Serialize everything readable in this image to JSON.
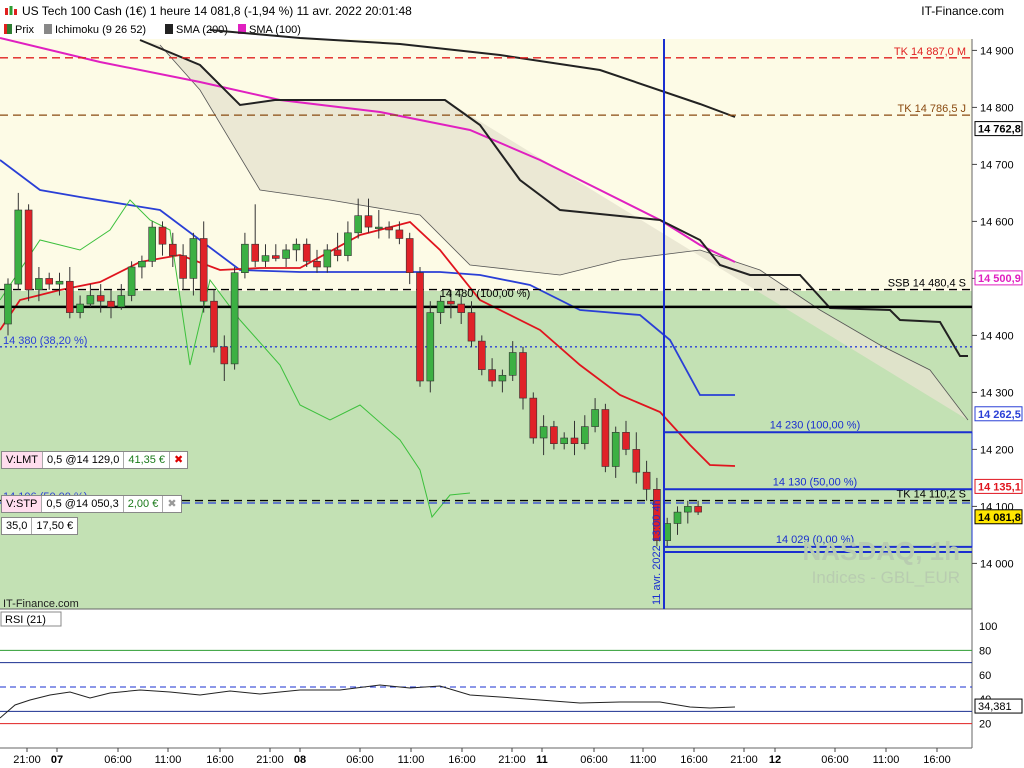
{
  "header": {
    "title": "US Tech 100 Cash (1€) 1 heure 14 081,8 (-1,94 %) 11 avr. 2022 20:01:48",
    "site": "IT-Finance.com"
  },
  "legend": [
    {
      "label": "Prix",
      "color": "#2e7d32"
    },
    {
      "label": "Ichimoku (9 26 52)",
      "color": "#888888"
    },
    {
      "label": "SMA (200)",
      "color": "#222222"
    },
    {
      "label": "SMA (100)",
      "color": "#e020c0"
    }
  ],
  "watermark": {
    "line1": "NASDAQ, 1h",
    "line2": "Indices - GBL_EUR"
  },
  "copyright": "IT-Finance.com",
  "orders": [
    {
      "type": "V:LMT",
      "detail": "0,5 @14 129,0",
      "value": "41,35 €"
    },
    {
      "type": "V:STP",
      "detail": "0,5 @14 050,3",
      "value": "2,00 €"
    }
  ],
  "order_row": [
    "35,0",
    "17,50 €"
  ],
  "crosshair_label": "11 avr. 2022 13:00 4h",
  "rsi": {
    "label": "RSI (21)",
    "value": "34,381",
    "ticks": [
      100,
      80,
      60,
      40,
      20
    ]
  },
  "chart_data": {
    "type": "candlestick",
    "title": "US Tech 100 Cash (1€) 1 heure",
    "y_range": [
      13920,
      14920
    ],
    "y_ticks": [
      14900,
      14800,
      14700,
      14600,
      14500,
      14400,
      14300,
      14200,
      14100,
      14000
    ],
    "x_labels": [
      "21:00",
      "07",
      "06:00",
      "11:00",
      "16:00",
      "21:00",
      "08",
      "06:00",
      "11:00",
      "16:00",
      "21:00",
      "11",
      "06:00",
      "11:00",
      "16:00",
      "21:00",
      "12",
      "06:00",
      "11:00",
      "16:00"
    ],
    "price_tags": [
      {
        "label": "14 762,8",
        "value": 14762.8,
        "color": "#000000"
      },
      {
        "label": "14 500,9",
        "value": 14500.9,
        "color": "#e020c0"
      },
      {
        "label": "14 262,5",
        "value": 14262.5,
        "color": "#2a3fd6"
      },
      {
        "label": "14 135,1",
        "value": 14135.1,
        "color": "#e0141e"
      },
      {
        "label": "14 081,8",
        "value": 14081.8,
        "color": "#000000"
      }
    ],
    "horizontal_lines": [
      {
        "label": "TK 14 887,0 M",
        "value": 14887,
        "color": "#e02020",
        "style": "dash"
      },
      {
        "label": "TK 14 786,5 J",
        "value": 14786.5,
        "color": "#8a4a10",
        "style": "dash"
      },
      {
        "label": "SSB 14 480,4 S",
        "value": 14480.4,
        "color": "#000000",
        "style": "dash"
      },
      {
        "label": "",
        "value": 14450,
        "color": "#000000",
        "style": "solid"
      },
      {
        "label": "14 380 (38,20 %)",
        "value": 14380,
        "color": "#2a3fd6",
        "style": "dot"
      },
      {
        "label": "TK 14 110,2 S",
        "value": 14110.2,
        "color": "#000000",
        "style": "dash"
      },
      {
        "label": "14 106 (50,00 %)",
        "value": 14106,
        "color": "#2a3fd6",
        "style": "dash"
      }
    ],
    "fibo": [
      {
        "label": "14 230 (100,00 %)",
        "value": 14230
      },
      {
        "label": "14 130 (50,00 %)",
        "value": 14130
      },
      {
        "label": "14 029 (0,00 %)",
        "value": 14029
      }
    ],
    "fibo_overlay": "14 480 (100,00 %)",
    "candles": [
      [
        14420,
        14500,
        14400,
        14490
      ],
      [
        14490,
        14650,
        14480,
        14620
      ],
      [
        14620,
        14630,
        14460,
        14480
      ],
      [
        14480,
        14520,
        14460,
        14500
      ],
      [
        14500,
        14510,
        14480,
        14490
      ],
      [
        14490,
        14510,
        14470,
        14495
      ],
      [
        14495,
        14520,
        14430,
        14440
      ],
      [
        14440,
        14470,
        14430,
        14455
      ],
      [
        14455,
        14490,
        14450,
        14470
      ],
      [
        14470,
        14490,
        14440,
        14460
      ],
      [
        14460,
        14480,
        14430,
        14450
      ],
      [
        14450,
        14490,
        14445,
        14470
      ],
      [
        14470,
        14530,
        14460,
        14520
      ],
      [
        14520,
        14540,
        14500,
        14530
      ],
      [
        14530,
        14600,
        14520,
        14590
      ],
      [
        14590,
        14600,
        14540,
        14560
      ],
      [
        14560,
        14580,
        14520,
        14540
      ],
      [
        14540,
        14560,
        14480,
        14500
      ],
      [
        14500,
        14580,
        14470,
        14570
      ],
      [
        14570,
        14600,
        14440,
        14460
      ],
      [
        14460,
        14480,
        14370,
        14380
      ],
      [
        14380,
        14400,
        14320,
        14350
      ],
      [
        14350,
        14520,
        14340,
        14510
      ],
      [
        14510,
        14580,
        14500,
        14560
      ],
      [
        14560,
        14630,
        14520,
        14530
      ],
      [
        14530,
        14560,
        14520,
        14540
      ],
      [
        14540,
        14560,
        14530,
        14535
      ],
      [
        14535,
        14560,
        14520,
        14550
      ],
      [
        14550,
        14570,
        14530,
        14560
      ],
      [
        14560,
        14570,
        14520,
        14530
      ],
      [
        14530,
        14550,
        14510,
        14520
      ],
      [
        14520,
        14560,
        14510,
        14550
      ],
      [
        14550,
        14580,
        14530,
        14540
      ],
      [
        14540,
        14600,
        14530,
        14580
      ],
      [
        14580,
        14640,
        14570,
        14610
      ],
      [
        14610,
        14640,
        14580,
        14590
      ],
      [
        14590,
        14620,
        14570,
        14590
      ],
      [
        14590,
        14600,
        14570,
        14585
      ],
      [
        14585,
        14600,
        14560,
        14570
      ],
      [
        14570,
        14580,
        14490,
        14510
      ],
      [
        14510,
        14520,
        14310,
        14320
      ],
      [
        14320,
        14460,
        14300,
        14440
      ],
      [
        14440,
        14470,
        14420,
        14460
      ],
      [
        14460,
        14480,
        14430,
        14455
      ],
      [
        14455,
        14470,
        14420,
        14440
      ],
      [
        14440,
        14460,
        14380,
        14390
      ],
      [
        14390,
        14400,
        14330,
        14340
      ],
      [
        14340,
        14360,
        14310,
        14320
      ],
      [
        14320,
        14340,
        14300,
        14330
      ],
      [
        14330,
        14390,
        14320,
        14370
      ],
      [
        14370,
        14380,
        14270,
        14290
      ],
      [
        14290,
        14300,
        14210,
        14220
      ],
      [
        14220,
        14260,
        14190,
        14240
      ],
      [
        14240,
        14250,
        14200,
        14210
      ],
      [
        14210,
        14230,
        14200,
        14220
      ],
      [
        14220,
        14250,
        14190,
        14210
      ],
      [
        14210,
        14260,
        14200,
        14240
      ],
      [
        14240,
        14290,
        14230,
        14270
      ],
      [
        14270,
        14280,
        14160,
        14170
      ],
      [
        14170,
        14240,
        14150,
        14230
      ],
      [
        14230,
        14250,
        14190,
        14200
      ],
      [
        14200,
        14230,
        14140,
        14160
      ],
      [
        14160,
        14180,
        14110,
        14130
      ],
      [
        14130,
        14150,
        14030,
        14040
      ],
      [
        14040,
        14080,
        14030,
        14070
      ],
      [
        14070,
        14100,
        14050,
        14090
      ],
      [
        14090,
        14110,
        14070,
        14100
      ],
      [
        14100,
        14110,
        14085,
        14090
      ]
    ]
  }
}
